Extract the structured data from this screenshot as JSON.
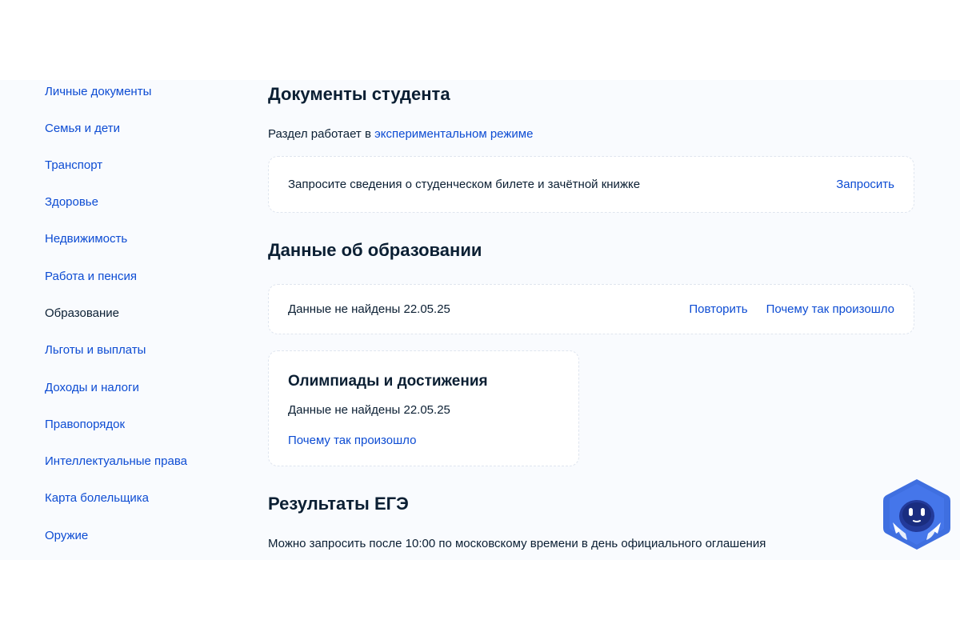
{
  "sidebar": {
    "items": [
      {
        "label": "Личные документы",
        "active": false
      },
      {
        "label": "Семья и дети",
        "active": false
      },
      {
        "label": "Транспорт",
        "active": false
      },
      {
        "label": "Здоровье",
        "active": false
      },
      {
        "label": "Недвижимость",
        "active": false
      },
      {
        "label": "Работа и пенсия",
        "active": false
      },
      {
        "label": "Образование",
        "active": true
      },
      {
        "label": "Льготы и выплаты",
        "active": false
      },
      {
        "label": "Доходы и налоги",
        "active": false
      },
      {
        "label": "Правопорядок",
        "active": false
      },
      {
        "label": "Интеллектуальные права",
        "active": false
      },
      {
        "label": "Карта болельщика",
        "active": false
      },
      {
        "label": "Оружие",
        "active": false
      }
    ]
  },
  "student_docs": {
    "title": "Документы студента",
    "note_prefix": "Раздел работает в ",
    "note_link": "экспериментальном режиме",
    "card_text": "Запросите сведения о студенческом билете и зачётной книжке",
    "card_action": "Запросить"
  },
  "education": {
    "title": "Данные об образовании",
    "status": "Данные не найдены 22.05.25",
    "retry": "Повторить",
    "why": "Почему так произошло"
  },
  "olympiads": {
    "title": "Олимпиады и достижения",
    "status": "Данные не найдены 22.05.25",
    "why": "Почему так произошло"
  },
  "ege": {
    "title": "Результаты ЕГЭ",
    "note": "Можно запросить после 10:00 по московскому времени в день официального оглашения"
  },
  "colors": {
    "link": "#0d4cd3",
    "text": "#0b1f33",
    "background": "#f9fbfe",
    "card": "#ffffff",
    "assistant": "#3f6fe0"
  },
  "icons": {
    "assistant": "robot-assistant-icon"
  }
}
